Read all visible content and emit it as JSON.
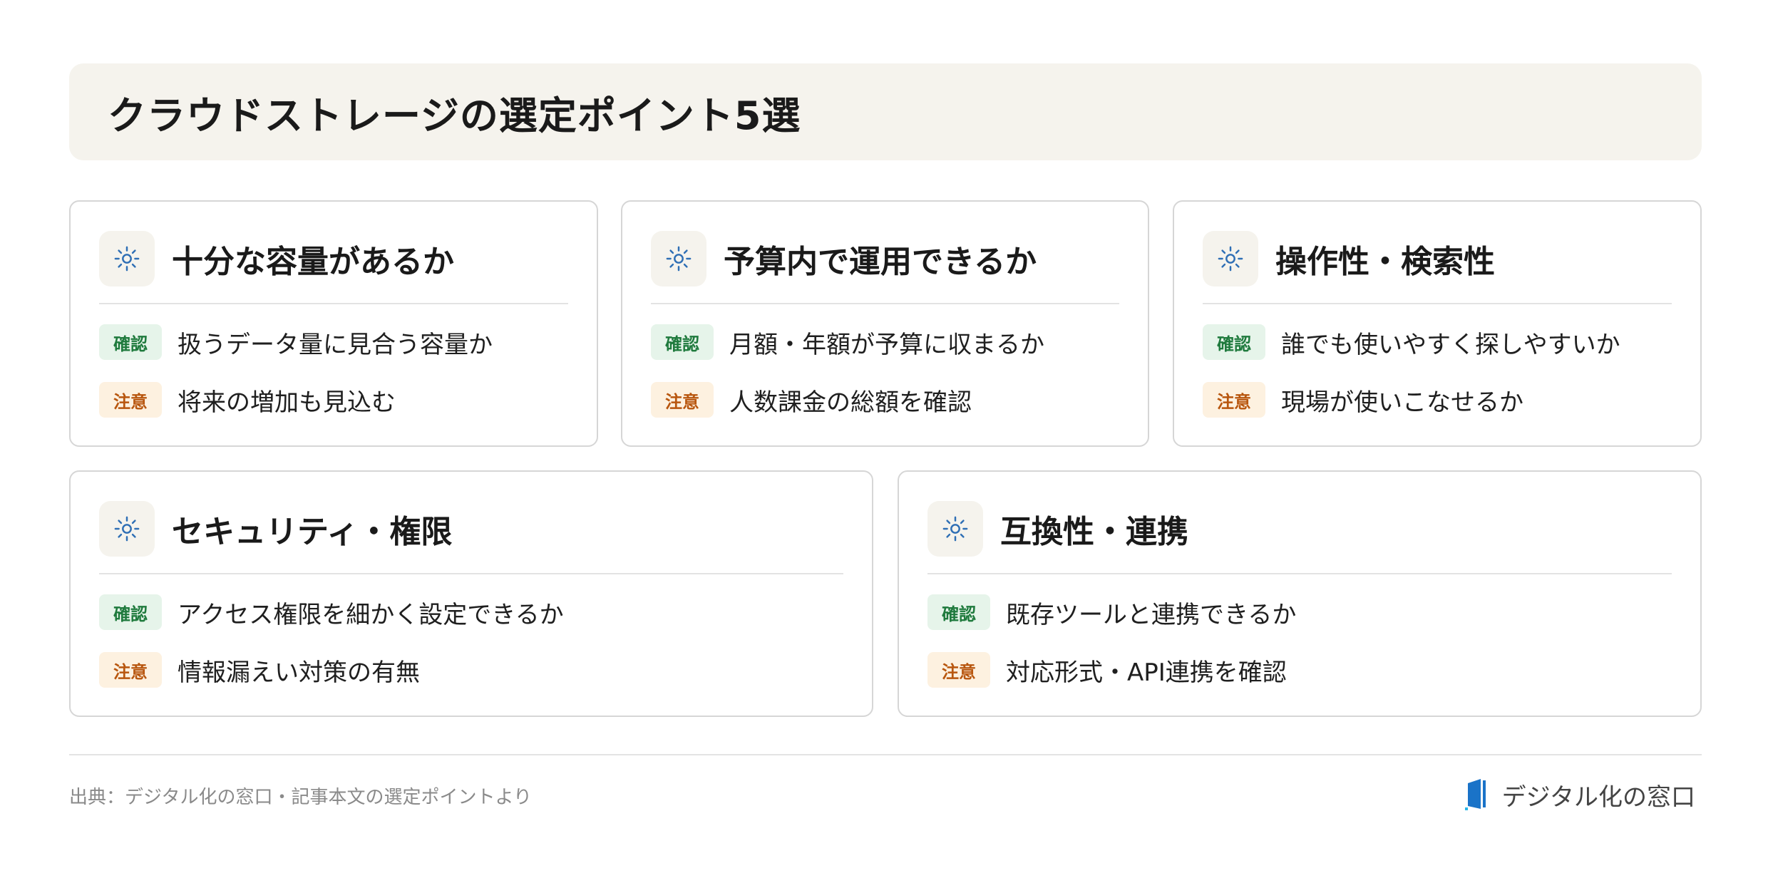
{
  "title": "クラウドストレージの選定ポイント5選",
  "badges": {
    "check": "確認",
    "caution": "注意"
  },
  "cards": [
    {
      "title": "十分な容量があるか",
      "check": "扱うデータ量に見合う容量か",
      "caution": "将来の増加も見込む"
    },
    {
      "title": "予算内で運用できるか",
      "check": "月額・年額が予算に収まるか",
      "caution": "人数課金の総額を確認"
    },
    {
      "title": "操作性・検索性",
      "check": "誰でも使いやすく探しやすいか",
      "caution": "現場が使いこなせるか"
    },
    {
      "title": "セキュリティ・権限",
      "check": "アクセス権限を細かく設定できるか",
      "caution": "情報漏えい対策の有無"
    },
    {
      "title": "互換性・連携",
      "check": "既存ツールと連携できるか",
      "caution": "対応形式・API連携を確認"
    }
  ],
  "footer": {
    "source": "出典：デジタル化の窓口・記事本文の選定ポイントより",
    "brand": "デジタル化の窓口"
  },
  "icons": {
    "card_icon": "sun-icon",
    "brand_icon": "door-logo-icon"
  },
  "colors": {
    "icon_blue": "#2f6fb5",
    "check_bg": "#e6f4ea",
    "check_text": "#1f7a3d",
    "caution_bg": "#fdf1e0",
    "caution_text": "#b8560e",
    "brand_blue": "#1a73c8"
  }
}
